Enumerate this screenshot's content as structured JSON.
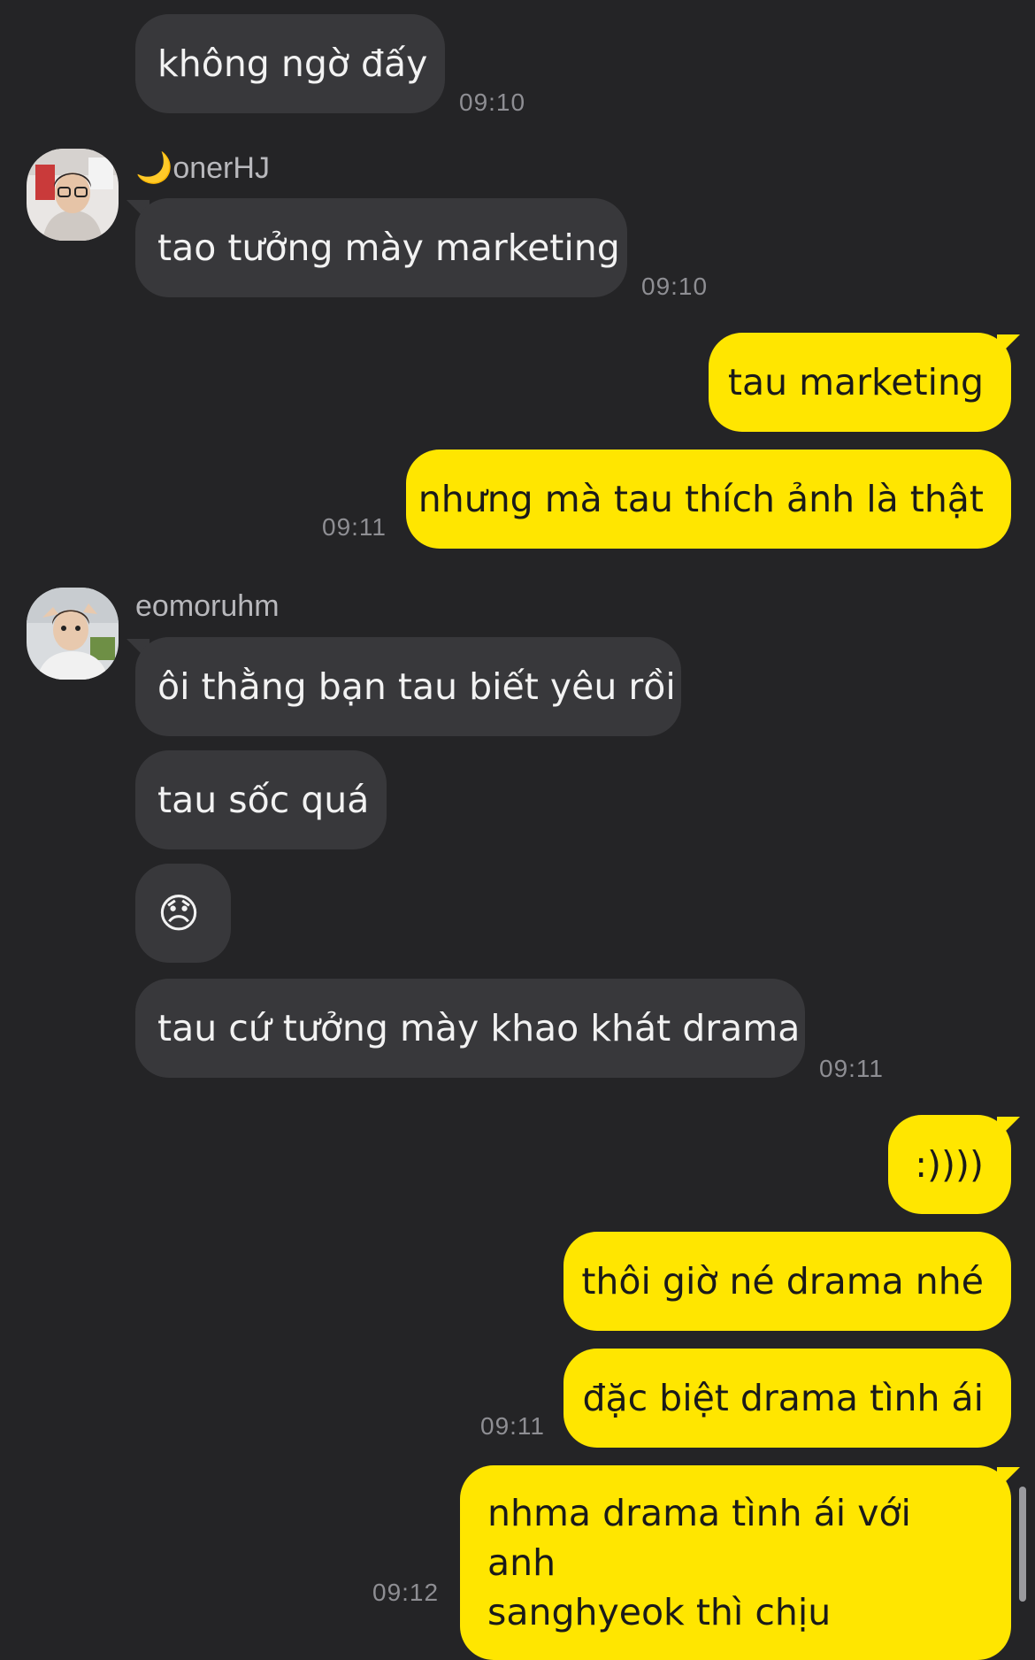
{
  "messages": {
    "m1": {
      "text": "không ngờ đấy",
      "time": "09:10"
    },
    "u1": {
      "name": "🌙onerHJ"
    },
    "m2": {
      "text": "tao tưởng mày marketing",
      "time": "09:10"
    },
    "o1": {
      "text": "tau marketing"
    },
    "o2": {
      "text": "nhưng mà tau thích ảnh là thật",
      "time": "09:11"
    },
    "u2": {
      "name": "eomoruhm"
    },
    "m3": {
      "text": "ôi thằng bạn tau biết yêu rồi"
    },
    "m4": {
      "text": "tau sốc quá"
    },
    "m5": {
      "emoji": "😞"
    },
    "m6": {
      "text": "tau cứ tưởng mày khao khát drama",
      "time": "09:11"
    },
    "o3": {
      "text": ":))))"
    },
    "o4": {
      "text": "thôi giờ né drama nhé"
    },
    "o5": {
      "text": "đặc biệt drama tình ái",
      "time": "09:11"
    },
    "o6": {
      "line1": "nhma drama tình ái với anh",
      "line2": "sanghyeok thì chịu",
      "time": "09:12"
    }
  },
  "colors": {
    "background": "#242426",
    "incoming_bubble": "#38383b",
    "outgoing_bubble": "#ffe600",
    "timestamp": "#8e8e93"
  },
  "icons": {
    "avatar1": "avatar-photo",
    "avatar2": "avatar-photo"
  }
}
